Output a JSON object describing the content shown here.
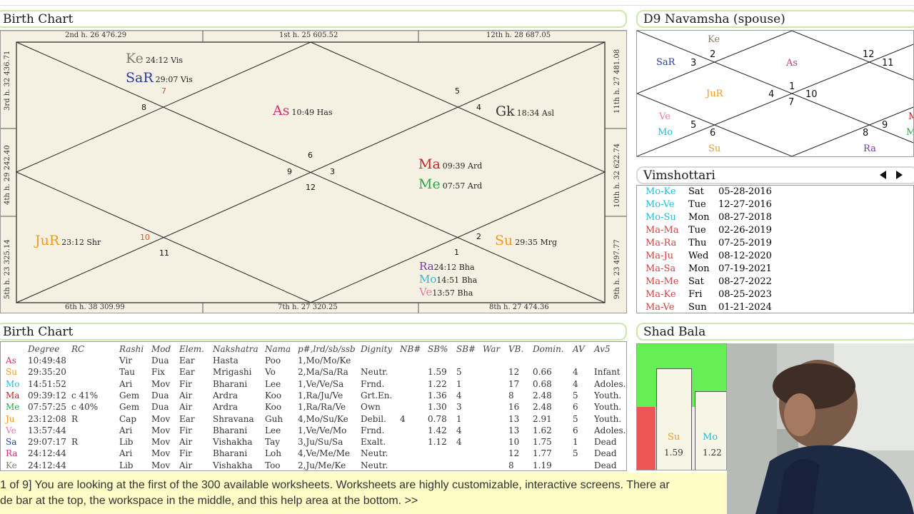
{
  "top_strip": {
    "left_text": "",
    "right_text": ""
  },
  "birth_chart": {
    "title": "Birth Chart",
    "house_labels": {
      "h2": "2nd h.  26  476.29",
      "h1": "1st h.  25  605.52",
      "h12": "12th h.  28  687.05",
      "h3": "3rd h.  32  436.71",
      "h4": "4th h.  29  242.40",
      "h5": "5th h.  23  325.14",
      "h11": "11th h.  27  481.08",
      "h10": "10th h.  32  622.74",
      "h9": "9th h.  23  497.77",
      "h6": "6th h.  38  309.99",
      "h7": "7th h.  27  320.25",
      "h8": "8th h.  27  474.36"
    },
    "planets": [
      {
        "abbr": "Ke",
        "deg": "24:12 Vis",
        "color": "#8a7a6a"
      },
      {
        "abbr": "SaR",
        "deg": "29:07 Vis",
        "color": "#2a3a9a"
      },
      {
        "abbr": "As",
        "deg": "10:49 Has",
        "color": "#cc3377"
      },
      {
        "abbr": "Gk",
        "deg": "18:34 Asl",
        "color": "#333333"
      },
      {
        "abbr": "Ma",
        "deg": "09:39 Ard",
        "color": "#cc2222"
      },
      {
        "abbr": "Me",
        "deg": "07:57 Ard",
        "color": "#22aa44"
      },
      {
        "abbr": "JuR",
        "deg": "23:12 Shr",
        "color": "#ee9922"
      },
      {
        "abbr": "Su",
        "deg": "29:35 Mrg",
        "color": "#ee9922"
      },
      {
        "abbr": "Ra",
        "deg": "24:12 Bha",
        "color": "#7733aa"
      },
      {
        "abbr": "Mo",
        "deg": "14:51 Bha",
        "color": "#22bbdd"
      },
      {
        "abbr": "Ve",
        "deg": "13:57 Bha",
        "color": "#ee77aa"
      }
    ],
    "house_numbers": {
      "n1": "1",
      "n2": "2",
      "n3": "3",
      "n4": "4",
      "n5": "5",
      "n6": "6",
      "n7": "7",
      "n8": "8",
      "n9": "9",
      "n10": "10",
      "n11": "11",
      "n12": "12"
    }
  },
  "navamsha": {
    "title": "D9 Navamsha  (spouse)",
    "planets": {
      "ke": "Ke",
      "sar": "SaR",
      "as": "As",
      "jur": "JuR",
      "ve": "Ve",
      "mo": "Mo",
      "su": "Su",
      "ra": "Ra",
      "m_edge": "M",
      "me_edge": "Me"
    },
    "numbers": {
      "n1": "1",
      "n2": "2",
      "n3": "3",
      "n4": "4",
      "n5": "5",
      "n6": "6",
      "n7": "7",
      "n8": "8",
      "n9": "9",
      "n10": "10",
      "n11": "11",
      "n12": "12"
    }
  },
  "vimshottari": {
    "title": "Vimshottari",
    "rows": [
      {
        "period": "Mo-Ke",
        "day": "Sat",
        "date": "05-28-2016",
        "color": "#22bbdd"
      },
      {
        "period": "Mo-Ve",
        "day": "Tue",
        "date": "12-27-2016",
        "color": "#22bbdd"
      },
      {
        "period": "Mo-Su",
        "day": "Mon",
        "date": "08-27-2018",
        "color": "#22bbdd"
      },
      {
        "period": "Ma-Ma",
        "day": "Tue",
        "date": "02-26-2019",
        "color": "#cc4444"
      },
      {
        "period": "Ma-Ra",
        "day": "Thu",
        "date": "07-25-2019",
        "color": "#cc4444"
      },
      {
        "period": "Ma-Ju",
        "day": "Wed",
        "date": "08-12-2020",
        "color": "#cc4444"
      },
      {
        "period": "Ma-Sa",
        "day": "Mon",
        "date": "07-19-2021",
        "color": "#cc4444"
      },
      {
        "period": "Ma-Me",
        "day": "Sat",
        "date": "08-27-2022",
        "color": "#cc4444"
      },
      {
        "period": "Ma-Ke",
        "day": "Fri",
        "date": "08-25-2023",
        "color": "#cc4444"
      },
      {
        "period": "Ma-Ve",
        "day": "Sun",
        "date": "01-21-2024",
        "color": "#cc4444"
      }
    ]
  },
  "table": {
    "title": "Birth Chart",
    "headers": [
      "Degree",
      "RC",
      "Rashi",
      "Mod",
      "Elem.",
      "Nakshatra",
      "Nama",
      "p#,lrd/sb/ssb",
      "Dignity",
      "NB#",
      "SB%",
      "SB#",
      "War",
      "VB.",
      "Domin.",
      "AV",
      "Av5"
    ],
    "rows": [
      {
        "p": "As",
        "c": "#cc3377",
        "cells": [
          "10:49:48",
          "",
          "Vir",
          "Dua",
          "Ear",
          "Hasta",
          "Poo",
          "1,Mo/Mo/Ke",
          "",
          "",
          "",
          "",
          "",
          "",
          "",
          "",
          ""
        ]
      },
      {
        "p": "Su",
        "c": "#ee9922",
        "cells": [
          "29:35:20",
          "",
          "Tau",
          "Fix",
          "Ear",
          "Mrigashi",
          "Vo",
          "2,Ma/Sa/Ra",
          "Neutr.",
          "",
          "1.59",
          "5",
          "",
          "12",
          "0.66",
          "4",
          "Infant"
        ]
      },
      {
        "p": "Mo",
        "c": "#22bbdd",
        "cells": [
          "14:51:52",
          "",
          "Ari",
          "Mov",
          "Fir",
          "Bharani",
          "Lee",
          "1,Ve/Ve/Sa",
          "Frnd.",
          "",
          "1.22",
          "1",
          "",
          "17",
          "0.68",
          "4",
          "Adoles."
        ]
      },
      {
        "p": "Ma",
        "c": "#cc2222",
        "cells": [
          "09:39:12",
          "c      41%",
          "Gem",
          "Dua",
          "Air",
          "Ardra",
          "Koo",
          "1,Ra/Ju/Ve",
          "Grt.En.",
          "",
          "1.36",
          "4",
          "",
          "8",
          "2.48",
          "5",
          "Youth."
        ]
      },
      {
        "p": "Me",
        "c": "#22aa44",
        "cells": [
          "07:57:25",
          "c      40%",
          "Gem",
          "Dua",
          "Air",
          "Ardra",
          "Koo",
          "1,Ra/Ra/Ve",
          "Own",
          "",
          "1.30",
          "3",
          "",
          "16",
          "2.48",
          "6",
          "Youth."
        ]
      },
      {
        "p": "Ju",
        "c": "#ee9922",
        "cells": [
          "23:12:08",
          "R",
          "Cap",
          "Mov",
          "Ear",
          "Shravana",
          "Guh",
          "4,Mo/Su/Ke",
          "Debil.",
          "4",
          "0.78",
          "1",
          "",
          "13",
          "2.91",
          "5",
          "Youth."
        ]
      },
      {
        "p": "Ve",
        "c": "#ee77aa",
        "cells": [
          "13:57:44",
          "",
          "Ari",
          "Mov",
          "Fir",
          "Bharani",
          "Lee",
          "1,Ve/Ve/Mo",
          "Frnd.",
          "",
          "1.42",
          "4",
          "",
          "13",
          "1.62",
          "6",
          "Adoles."
        ]
      },
      {
        "p": "Sa",
        "c": "#2a3a9a",
        "cells": [
          "29:07:17",
          "R",
          "Lib",
          "Mov",
          "Air",
          "Vishakha",
          "Tay",
          "3,Ju/Su/Sa",
          "Exalt.",
          "",
          "1.12",
          "4",
          "",
          "10",
          "1.75",
          "1",
          "Dead"
        ]
      },
      {
        "p": "Ra",
        "c": "#cc3377",
        "cells": [
          "24:12:44",
          "",
          "Ari",
          "Mov",
          "Fir",
          "Bharani",
          "Loh",
          "4,Ve/Me/Me",
          "Neutr.",
          "",
          "",
          "",
          "",
          "12",
          "1.77",
          "5",
          "Dead"
        ]
      },
      {
        "p": "Ke",
        "c": "#8a7a6a",
        "cells": [
          "24:12:44",
          "",
          "Lib",
          "Mov",
          "Air",
          "Vishakha",
          "Too",
          "2,Ju/Me/Ke",
          "Neutr.",
          "",
          "",
          "",
          "",
          "8",
          "1.19",
          "",
          "Dead"
        ]
      }
    ]
  },
  "shad_bala": {
    "title": "Shad Bala",
    "bars": [
      {
        "planet": "Su",
        "value": "1.59",
        "color": "#ee9922"
      },
      {
        "planet": "Mo",
        "value": "1.22",
        "color": "#22bbdd"
      }
    ]
  },
  "help": {
    "line1": "1 of 9] You are looking at the first of the 300 available worksheets. Worksheets are highly customizable, interactive screens. There ar",
    "line2": "de bar at the top, the workspace in the middle, and this help area at the bottom. >>"
  },
  "colors": {
    "panel_border": "#cfe8a8",
    "chart_bg": "#f4f0e2",
    "help_bg": "#fdfbc6",
    "green": "#66ee55",
    "red": "#ee5555"
  }
}
